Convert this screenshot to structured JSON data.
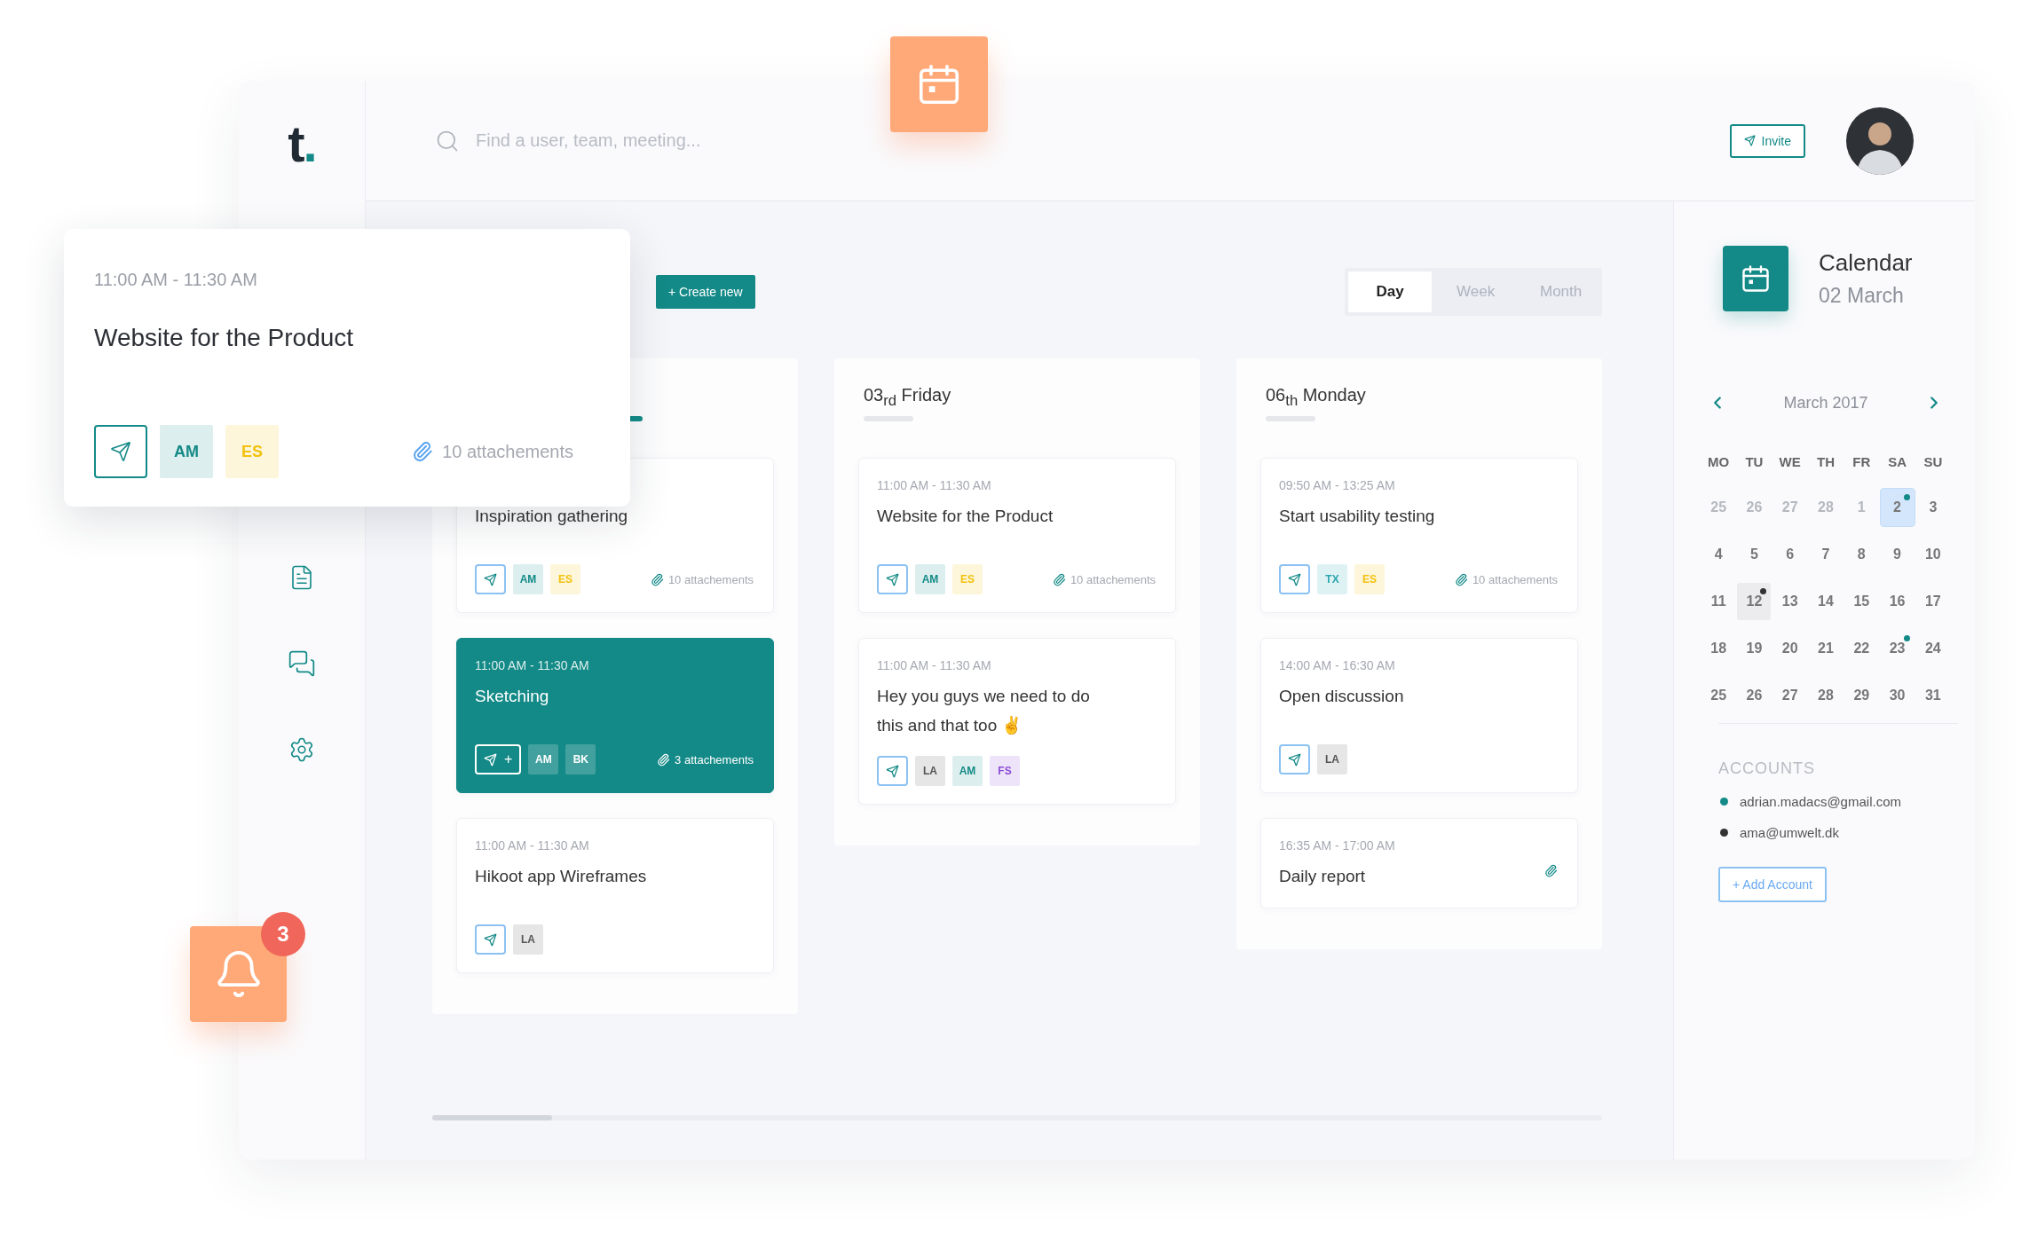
{
  "logo": {
    "letter": "t",
    "dot": "."
  },
  "search": {
    "placeholder": "Find a user, team, meeting..."
  },
  "invite_button": {
    "label": "Invite"
  },
  "toolbar": {
    "create_button": "+ Create new",
    "views": [
      {
        "label": "Day",
        "selected": true
      },
      {
        "label": "Week",
        "selected": false
      },
      {
        "label": "Month",
        "selected": false
      }
    ]
  },
  "columns": [
    {
      "highlighted": true,
      "cards": [
        {
          "highlighted": false,
          "title": "Inspiration gathering",
          "participants": [
            {
              "text": "AM",
              "color": "#138a87"
            },
            {
              "text": "ES",
              "color": "#f2c20f"
            }
          ],
          "attachment_icon": true,
          "attachments": "10 attachements"
        },
        {
          "highlighted": true,
          "time": "11:00 AM - 11:30 AM",
          "title": "Sketching",
          "share_label": "+",
          "participants": [
            {
              "text": "AM"
            },
            {
              "text": "BK"
            }
          ],
          "attachment_icon": true,
          "attachments": "3 attachements"
        },
        {
          "highlighted": false,
          "time": "11:00 AM - 11:30 AM",
          "title": "Hikoot app Wireframes",
          "participants": [
            {
              "text": "LA",
              "color": "#555555"
            }
          ],
          "attachment_icon": false
        }
      ]
    },
    {
      "highlighted": false,
      "title": "03$_{rd}$ Friday",
      "cards": [
        {
          "highlighted": false,
          "time": "11:00 AM - 11:30 AM",
          "title": "Website for the Product",
          "participants": [
            {
              "text": "AM",
              "color": "#138a87"
            },
            {
              "text": "ES",
              "color": "#f2c20f"
            }
          ],
          "attachment_icon": true,
          "attachments": "10 attachements"
        },
        {
          "highlighted": false,
          "time": "11:00 AM - 11:30 AM",
          "title": "Hey you guys we need to do this and that too ✌",
          "participants": [
            {
              "text": "LA",
              "color": "#555555"
            },
            {
              "text": "AM",
              "color": "#138a87"
            },
            {
              "text": "FS",
              "color": "#8a4bd6"
            }
          ],
          "attachment_icon": false
        }
      ]
    },
    {
      "highlighted": false,
      "title": "06$_{th}$ Monday",
      "cards": [
        {
          "highlighted": false,
          "time": "09:50 AM - 13:25 AM",
          "title": "Start usability testing",
          "participants": [
            {
              "text": "TX",
              "color": "#2aa6b0"
            },
            {
              "text": "ES",
              "color": "#f2c20f"
            }
          ],
          "attachment_icon": true,
          "attachments": "10 attachements"
        },
        {
          "highlighted": false,
          "time": "14:00 AM - 16:30 AM",
          "title": "Open discussion",
          "participants": [
            {
              "text": "LA",
              "color": "#555555"
            }
          ],
          "attachment_icon": false
        },
        {
          "highlighted": false,
          "time": "16:35 AM - 17:00 AM",
          "title": "Daily report",
          "attachment_icon": true
        }
      ]
    }
  ],
  "calendar": {
    "title": "Calendar",
    "date": "02 March",
    "month": "March 2017",
    "weekdays": [
      "MO",
      "TU",
      "WE",
      "TH",
      "FR",
      "SA",
      "SU"
    ],
    "days": [
      {
        "day": "25",
        "muted": true,
        "selected": false,
        "marked": false
      },
      {
        "day": "26",
        "muted": true,
        "selected": false,
        "marked": false
      },
      {
        "day": "27",
        "muted": true,
        "selected": false,
        "marked": false
      },
      {
        "day": "28",
        "muted": true,
        "selected": false,
        "marked": false
      },
      {
        "day": "1",
        "muted": true,
        "selected": false,
        "marked": false
      },
      {
        "day": "2",
        "muted": false,
        "selected": true,
        "marked": false,
        "color": "#138a87"
      },
      {
        "day": "3",
        "muted": false,
        "selected": false,
        "marked": false
      },
      {
        "day": "4",
        "muted": false,
        "selected": false,
        "marked": false
      },
      {
        "day": "5",
        "muted": false,
        "selected": false,
        "marked": false
      },
      {
        "day": "6",
        "muted": false,
        "selected": false,
        "marked": false
      },
      {
        "day": "7",
        "muted": false,
        "selected": false,
        "marked": false
      },
      {
        "day": "8",
        "muted": false,
        "selected": false,
        "marked": false
      },
      {
        "day": "9",
        "muted": false,
        "selected": false,
        "marked": false
      },
      {
        "day": "10",
        "muted": false,
        "selected": false,
        "marked": false
      },
      {
        "day": "11",
        "muted": false,
        "selected": false,
        "marked": false
      },
      {
        "day": "12",
        "muted": false,
        "selected": false,
        "marked": true,
        "color": "#333333"
      },
      {
        "day": "13",
        "muted": false,
        "selected": false,
        "marked": false
      },
      {
        "day": "14",
        "muted": false,
        "selected": false,
        "marked": false
      },
      {
        "day": "15",
        "muted": false,
        "selected": false,
        "marked": false
      },
      {
        "day": "16",
        "muted": false,
        "selected": false,
        "marked": false
      },
      {
        "day": "17",
        "muted": false,
        "selected": false,
        "marked": false
      },
      {
        "day": "18",
        "muted": false,
        "selected": false,
        "marked": false
      },
      {
        "day": "19",
        "muted": false,
        "selected": false,
        "marked": false
      },
      {
        "day": "20",
        "muted": false,
        "selected": false,
        "marked": false
      },
      {
        "day": "21",
        "muted": false,
        "selected": false,
        "marked": false
      },
      {
        "day": "22",
        "muted": false,
        "selected": false,
        "marked": false
      },
      {
        "day": "23",
        "muted": false,
        "selected": false,
        "marked": false,
        "color": "#138a87"
      },
      {
        "day": "24",
        "muted": false,
        "selected": false,
        "marked": false
      },
      {
        "day": "25",
        "muted": false,
        "selected": false,
        "marked": false
      },
      {
        "day": "26",
        "muted": false,
        "selected": false,
        "marked": false
      },
      {
        "day": "27",
        "muted": false,
        "selected": false,
        "marked": false
      },
      {
        "day": "28",
        "muted": false,
        "selected": false,
        "marked": false
      },
      {
        "day": "29",
        "muted": false,
        "selected": false,
        "marked": false
      },
      {
        "day": "30",
        "muted": false,
        "selected": false,
        "marked": false
      },
      {
        "day": "31",
        "muted": false,
        "selected": false,
        "marked": false
      }
    ]
  },
  "accounts": {
    "heading": "ACCOUNTS",
    "items": [
      {
        "email": "adrian.madacs@gmail.com",
        "color": "#138a87"
      },
      {
        "email": "ama@umwelt.dk",
        "color": "#333333"
      }
    ],
    "add_button": "+ Add Account"
  },
  "popup": {
    "time": "11:00 AM - 11:30 AM",
    "title": "Website for the Product",
    "participants": [
      {
        "text": "AM",
        "color": "#138a87"
      },
      {
        "text": "ES",
        "color": "#f2c20f"
      }
    ],
    "attachments": "10 attachements"
  },
  "notifications": {
    "count": "3"
  }
}
